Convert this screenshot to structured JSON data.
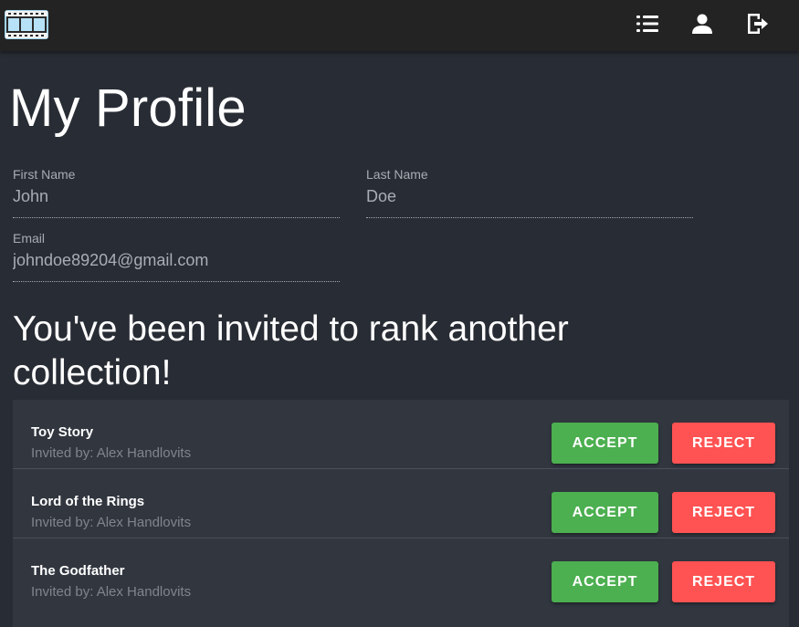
{
  "topbar": {
    "logo_icon": "film-strip-icon",
    "icons": [
      "list-icon",
      "user-icon",
      "logout-icon"
    ],
    "background": "#232323"
  },
  "page": {
    "title": "My Profile",
    "background": "#282c34"
  },
  "profile": {
    "first_name": {
      "label": "First Name",
      "value": "John"
    },
    "last_name": {
      "label": "Last Name",
      "value": "Doe"
    },
    "email": {
      "label": "Email",
      "value": "johndoe89204@gmail.com"
    }
  },
  "invitations": {
    "heading": "You've been invited to rank another collection!",
    "accept_label": "ACCEPT",
    "reject_label": "REJECT",
    "accept_color": "#4caf50",
    "reject_color": "#ff5252",
    "items": [
      {
        "name": "Toy Story",
        "invited_by": "Invited by: Alex Handlovits"
      },
      {
        "name": "Lord of the Rings",
        "invited_by": "Invited by: Alex Handlovits"
      },
      {
        "name": "The Godfather",
        "invited_by": "Invited by: Alex Handlovits"
      }
    ]
  }
}
